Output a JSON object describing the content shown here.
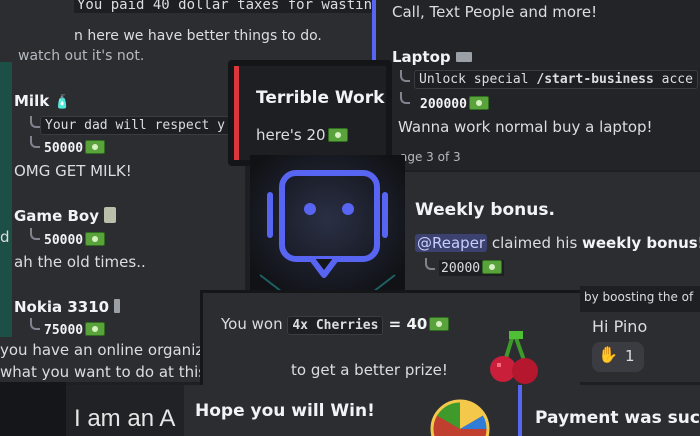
{
  "top_left": {
    "line1": "You paid 40 dollar taxes for wasting",
    "line2": "n here we have better things to do.",
    "line3": "watch out it's not."
  },
  "shop_left": {
    "milk": {
      "name": "Milk",
      "desc": "Your dad will respect y",
      "price": "50000",
      "note": "OMG GET MILK!"
    },
    "gameboy": {
      "name": "Game Boy",
      "prefix": "d",
      "price": "50000",
      "note": "ah the old times.."
    },
    "nokia": {
      "name": "Nokia 3310",
      "price": "75000"
    }
  },
  "shop_right": {
    "top_line": "Call, Text People and more!",
    "laptop": {
      "name": "Laptop",
      "desc_prefix": "Unlock special ",
      "desc_cmd": "/start-business",
      "desc_suffix": " acce",
      "price": "200000",
      "note": "Wanna work normal buy a laptop!"
    },
    "page": "age 3 of 3"
  },
  "terrible_work": {
    "title": "Terrible Work",
    "desc_prefix": "here's 20"
  },
  "weekly": {
    "title": "Weekly bonus.",
    "mention": "@Reaper",
    "text_mid": " claimed his ",
    "text_bold": "weekly bonus!",
    "amount": "20000"
  },
  "boost": {
    "text": "by boosting the of"
  },
  "hi_pino": {
    "text": "Hi Pino",
    "reaction_count": "1"
  },
  "cherries": {
    "prefix": "You won ",
    "item": "4x Cherries",
    "eq": " = 40",
    "sub": "to get a better prize!"
  },
  "org": {
    "line1": "you have an online organization.",
    "line2": "what you want to do at this moment,"
  },
  "bottom": {
    "iam": "I am an A",
    "hope": "Hope you will Win!",
    "payment": "Payment was succe"
  },
  "colors": {
    "red_accent": "#da373c",
    "blurple": "#5865f2",
    "robot_blue": "#5865f2"
  }
}
